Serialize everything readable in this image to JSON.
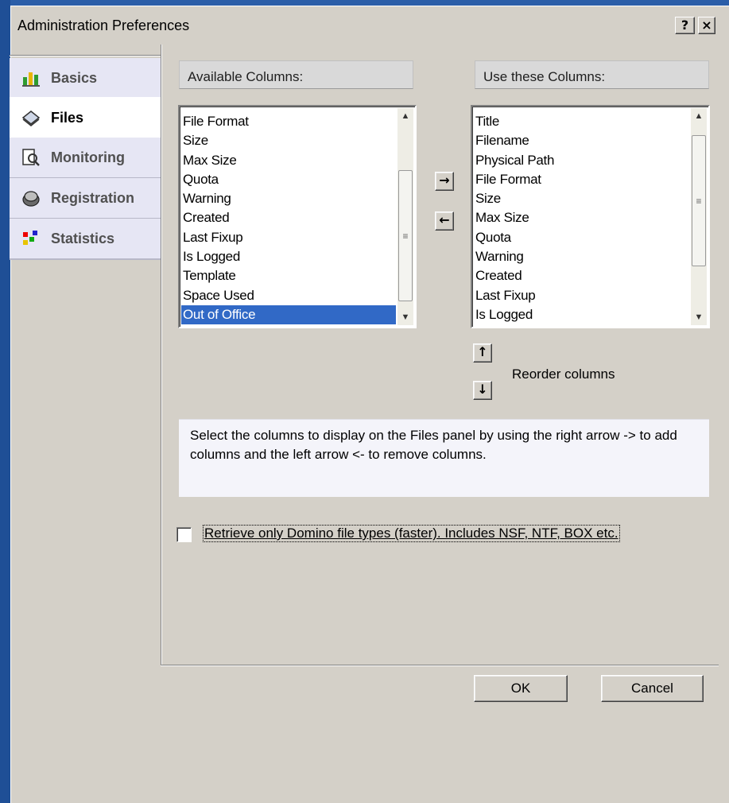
{
  "window": {
    "title": "Administration Preferences",
    "help_glyph": "?",
    "close_glyph": "×"
  },
  "sidebar": {
    "items": [
      {
        "label": "Basics",
        "icon": "basics-icon"
      },
      {
        "label": "Files",
        "icon": "files-icon",
        "selected": true
      },
      {
        "label": "Monitoring",
        "icon": "monitoring-icon"
      },
      {
        "label": "Registration",
        "icon": "registration-icon"
      },
      {
        "label": "Statistics",
        "icon": "statistics-icon"
      }
    ]
  },
  "available": {
    "header": "Available Columns:",
    "items": [
      "File Format",
      "Size",
      "Max Size",
      "Quota",
      "Warning",
      "Created",
      "Last Fixup",
      "Is Logged",
      "Template",
      "Space Used",
      "Out of Office"
    ],
    "selected": "Out of Office"
  },
  "use": {
    "header": "Use these Columns:",
    "items": [
      "Title",
      "Filename",
      "Physical Path",
      "File Format",
      "Size",
      "Max Size",
      "Quota",
      "Warning",
      "Created",
      "Last Fixup",
      "Is Logged"
    ]
  },
  "buttons": {
    "add_glyph": "→",
    "remove_glyph": "←",
    "up_glyph": "↑",
    "down_glyph": "↓",
    "ok": "OK",
    "cancel": "Cancel"
  },
  "reorder_label": "Reorder columns",
  "info_text": "Select the columns to display on the Files panel by using the right arrow -> to add columns and the left arrow <- to remove columns.",
  "checkbox": {
    "label": "Retrieve only Domino file types (faster). Includes NSF, NTF, BOX etc.",
    "checked": false
  },
  "colors": {
    "selection": "#3169c6",
    "sidebar_tab": "#e6e6f4",
    "dialog_bg": "#d4d0c8"
  }
}
